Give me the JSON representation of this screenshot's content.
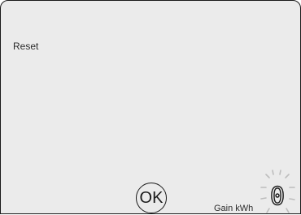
{
  "screen": {
    "label": "Reset",
    "ok_button": "OK",
    "gain": {
      "value": "0",
      "unit_label": "Gain kWh",
      "state": "blinking"
    }
  },
  "colors": {
    "screen_background": "#ebebeb",
    "outline": "#1a1a1a",
    "blink_rays": "#bdbdbd"
  },
  "icons": [
    "glow-rays-icon"
  ]
}
